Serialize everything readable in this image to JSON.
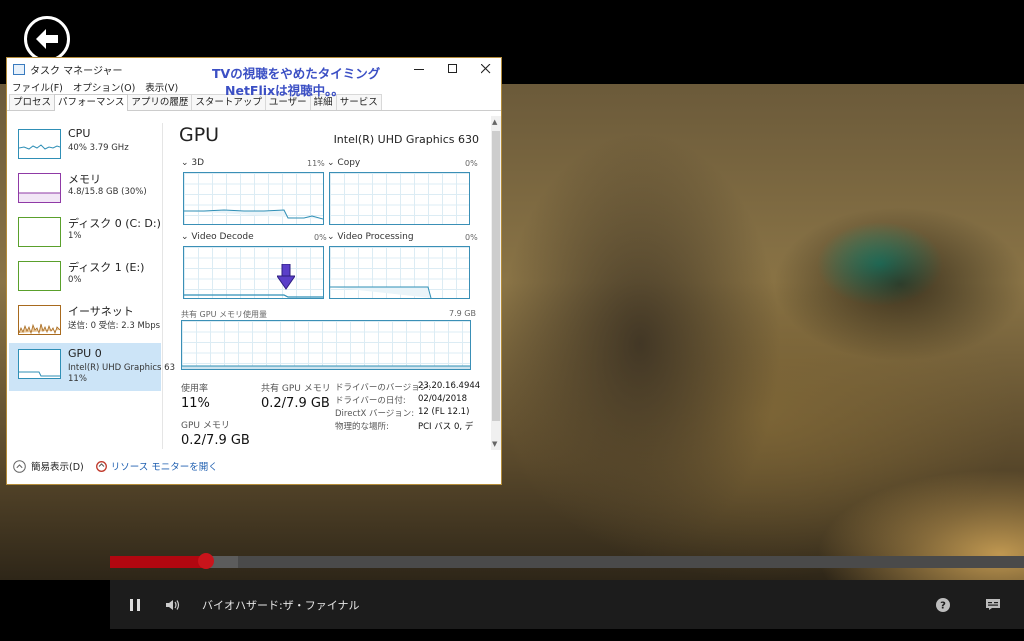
{
  "video": {
    "title": "バイオハザード:ザ・ファイナル",
    "progress_played": 0.105,
    "progress_buffered": 0.14
  },
  "icons": {
    "back": "back-arrow-icon",
    "pause": "pause-icon",
    "volume": "volume-icon",
    "help": "help-icon",
    "subtitles": "subtitles-icon"
  },
  "task_manager": {
    "title": "タスク マネージャー",
    "annotation_line1": "TVの視聴をやめたタイミング",
    "annotation_line2": "NetFlixは視聴中。。",
    "menu": [
      "ファイル(F)",
      "オプション(O)",
      "表示(V)"
    ],
    "tabs": [
      "プロセス",
      "パフォーマンス",
      "アプリの履歴",
      "スタートアップ",
      "ユーザー",
      "詳細",
      "サービス"
    ],
    "active_tab": "パフォーマンス",
    "sidebar": [
      {
        "name": "CPU",
        "sub": "40% 3.79 GHz",
        "sub2": "",
        "color": "#2f8fb6"
      },
      {
        "name": "メモリ",
        "sub": "4.8/15.8 GB (30%)",
        "sub2": "",
        "color": "#8f3aa6"
      },
      {
        "name": "ディスク 0 (C: D:)",
        "sub": "1%",
        "sub2": "",
        "color": "#5aa02c"
      },
      {
        "name": "ディスク 1 (E:)",
        "sub": "0%",
        "sub2": "",
        "color": "#5aa02c"
      },
      {
        "name": "イーサネット",
        "sub": "送信: 0 受信: 2.3 Mbps",
        "sub2": "",
        "color": "#a86a1e"
      },
      {
        "name": "GPU 0",
        "sub": "Intel(R) UHD Graphics 63",
        "sub2": "11%",
        "color": "#2f8fb6"
      }
    ],
    "gpu": {
      "heading": "GPU",
      "model": "Intel(R) UHD Graphics 630",
      "graphs": [
        {
          "label": "3D",
          "pct": "11%"
        },
        {
          "label": "Copy",
          "pct": "0%"
        },
        {
          "label": "Video Decode",
          "pct": "0%"
        },
        {
          "label": "Video Processing",
          "pct": "0%"
        }
      ],
      "shared_mem_label": "共有 GPU メモリ使用量",
      "shared_mem_max": "7.9 GB",
      "stats": {
        "usage_label": "使用率",
        "usage_value": "11%",
        "shared_label": "共有 GPU メモリ",
        "shared_value": "0.2/7.9 GB",
        "gpu_mem_label": "GPU メモリ",
        "gpu_mem_value": "0.2/7.9 GB"
      },
      "info": [
        {
          "key": "ドライバーのバージョン:",
          "val": "23.20.16.4944"
        },
        {
          "key": "ドライバーの日付:",
          "val": "02/04/2018"
        },
        {
          "key": "DirectX バージョン:",
          "val": "12 (FL 12.1)"
        },
        {
          "key": "物理的な場所:",
          "val": "PCI バス 0, デ"
        }
      ]
    },
    "footer": {
      "fewer_details": "簡易表示(D)",
      "resource_monitor": "リソース モニターを開く"
    }
  }
}
